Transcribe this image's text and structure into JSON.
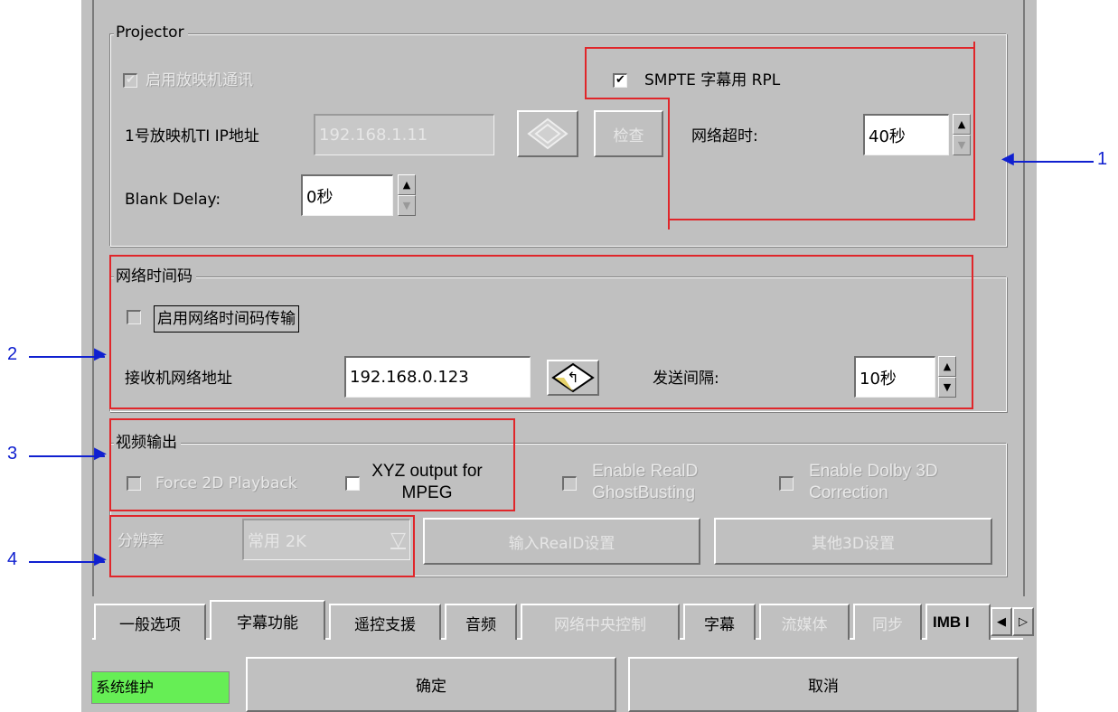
{
  "projector": {
    "legend": "Projector",
    "enable_comm_label": "启用放映机通讯",
    "enable_comm_checked": true,
    "smpte_label": "SMPTE 字幕用 RPL",
    "smpte_checked": true,
    "ti_ip_label": "1号放映机TI IP地址",
    "ti_ip_value": "192.168.1.11",
    "check_label": "检查",
    "timeout_label": "网络超时:",
    "timeout_value": "40秒",
    "blank_delay_label": "Blank Delay:",
    "blank_delay_value": "0秒"
  },
  "timecode": {
    "legend": "网络时间码",
    "enable_label": "启用网络时间码传输",
    "enable_checked": false,
    "receiver_label": "接收机网络地址",
    "receiver_value": "192.168.0.123",
    "interval_label": "发送间隔:",
    "interval_value": "10秒"
  },
  "video": {
    "legend": "视频输出",
    "force2d_label": "Force 2D Playback",
    "xyz_label": "XYZ output for MPEG",
    "realid_ghost_label": "Enable RealD GhostBusting",
    "dolby3d_label": "Enable Dolby 3D Correction",
    "resolution_label": "分辨率",
    "resolution_value": "常用 2K",
    "realid_settings_label": "输入RealD设置",
    "other3d_label": "其他3D设置"
  },
  "tabs": [
    {
      "label": "一般选项",
      "state": "normal"
    },
    {
      "label": "字幕功能",
      "state": "active"
    },
    {
      "label": "遥控支援",
      "state": "normal"
    },
    {
      "label": "音频",
      "state": "normal"
    },
    {
      "label": "网络中央控制",
      "state": "disabled"
    },
    {
      "label": "字幕",
      "state": "normal"
    },
    {
      "label": "流媒体",
      "state": "disabled"
    },
    {
      "label": "同步",
      "state": "disabled"
    },
    {
      "label": "IMB I",
      "state": "normal"
    }
  ],
  "footer": {
    "status": "系统维护",
    "status_color": "#66ee55",
    "ok_label": "确定",
    "cancel_label": "取消"
  },
  "annotations": [
    "1",
    "2",
    "3",
    "4"
  ],
  "colors": {
    "panel": "#c0c0c0",
    "highlight_box": "#e0262a",
    "arrow": "#1020d0"
  }
}
